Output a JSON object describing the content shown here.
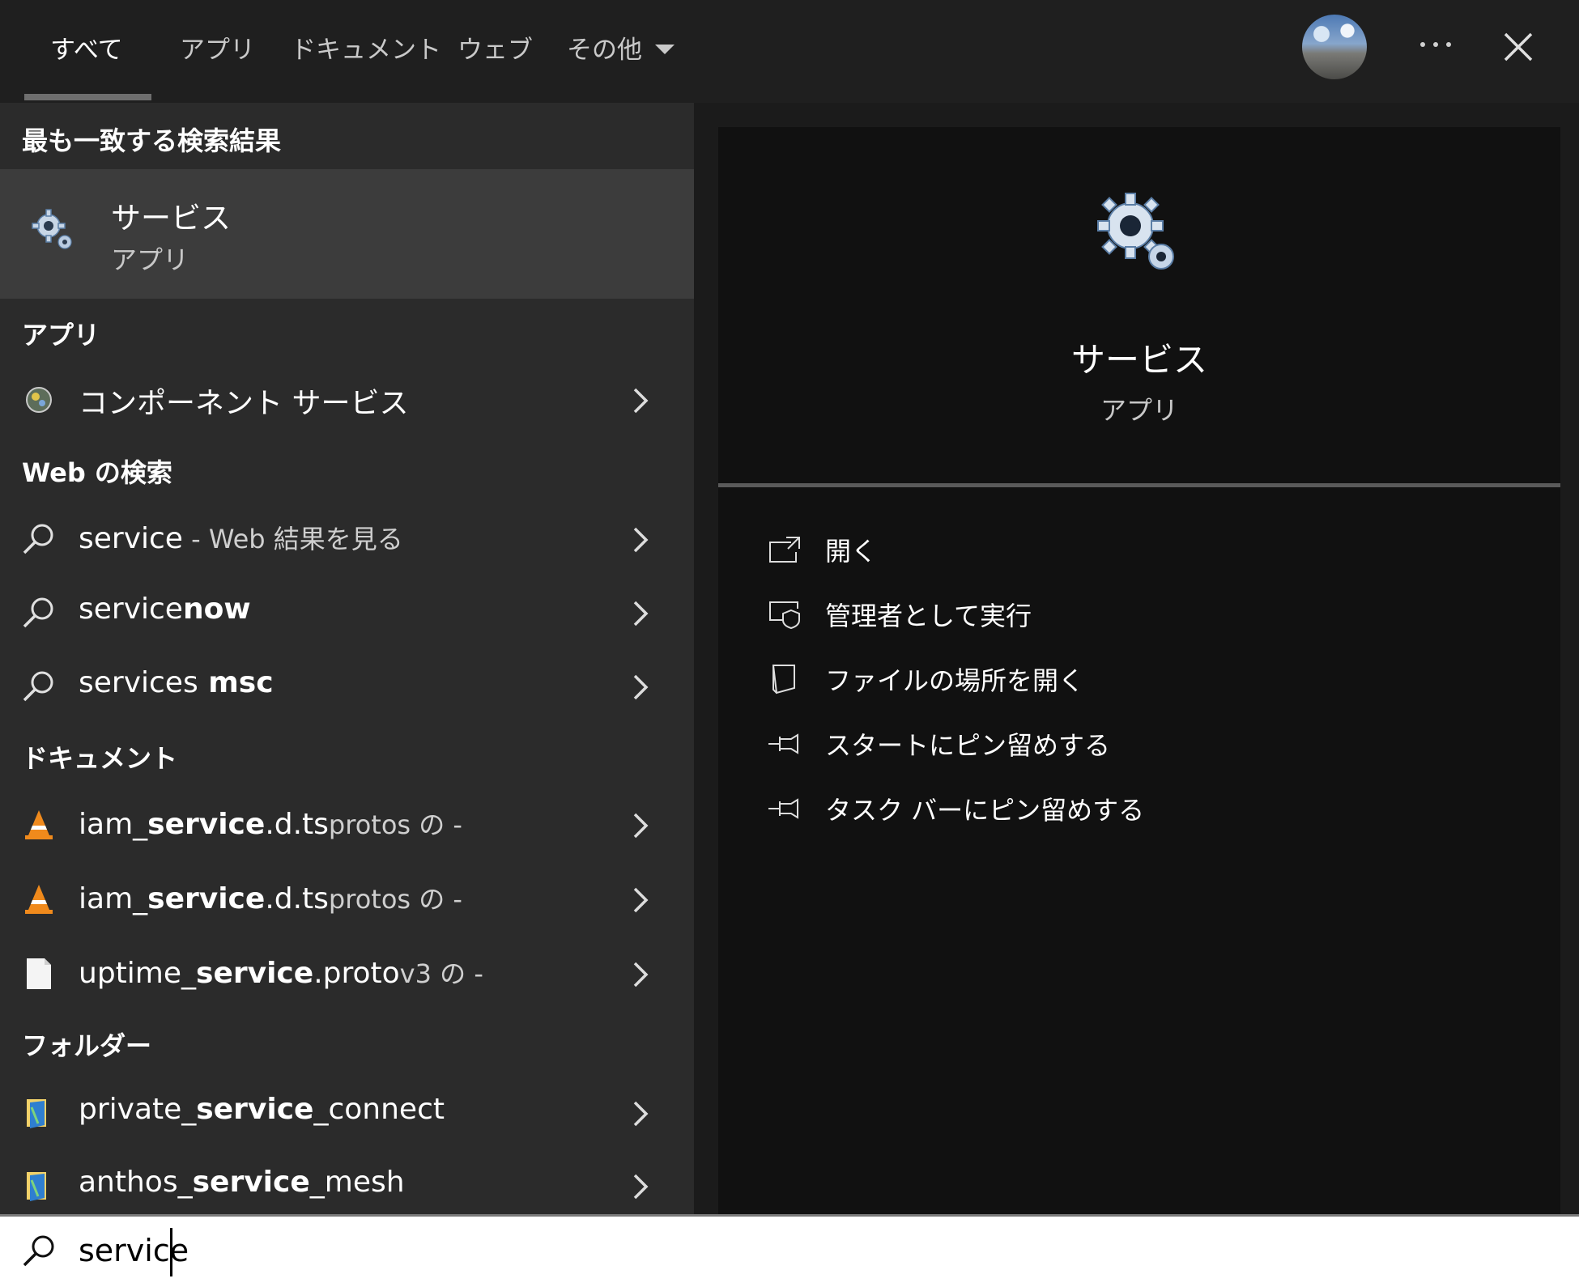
{
  "tabs": [
    {
      "label": "すべて"
    },
    {
      "label": "アプリ"
    },
    {
      "label": "ドキュメント"
    },
    {
      "label": "ウェブ"
    },
    {
      "label": "その他"
    }
  ],
  "sections": {
    "best_match": "最も一致する検索結果",
    "apps": "アプリ",
    "web": "Web の検索",
    "documents": "ドキュメント",
    "folders": "フォルダー"
  },
  "best_match": {
    "title": "サービス",
    "subtitle": "アプリ"
  },
  "apps": [
    {
      "label": "コンポーネント サービス"
    }
  ],
  "web": [
    {
      "main": "service",
      "suffix": " - Web 結果を見る"
    },
    {
      "main": "service",
      "bold": "now"
    },
    {
      "main": "services",
      "bold": " msc"
    }
  ],
  "documents": [
    {
      "pre": "iam_",
      "bold": "service",
      "post": ".d.ts",
      "small": "protos の -"
    },
    {
      "pre": "iam_",
      "bold": "service",
      "post": ".d.ts",
      "small": "protos の -"
    },
    {
      "pre": "uptime_",
      "bold": "service",
      "post": ".proto",
      "small": "v3 の -"
    }
  ],
  "folders": [
    {
      "pre": "private_",
      "bold": "service",
      "post": "_connect"
    },
    {
      "pre": "anthos_",
      "bold": "service",
      "post": "_mesh"
    }
  ],
  "preview": {
    "title": "サービス",
    "subtitle": "アプリ"
  },
  "actions": [
    {
      "label": "開く",
      "icon": "open-icon"
    },
    {
      "label": "管理者として実行",
      "icon": "run-as-admin-icon"
    },
    {
      "label": "ファイルの場所を開く",
      "icon": "open-file-location-icon"
    },
    {
      "label": "スタートにピン留めする",
      "icon": "pin-icon"
    },
    {
      "label": "タスク バーにピン留めする",
      "icon": "pin-icon"
    }
  ],
  "search": {
    "value": "service"
  }
}
